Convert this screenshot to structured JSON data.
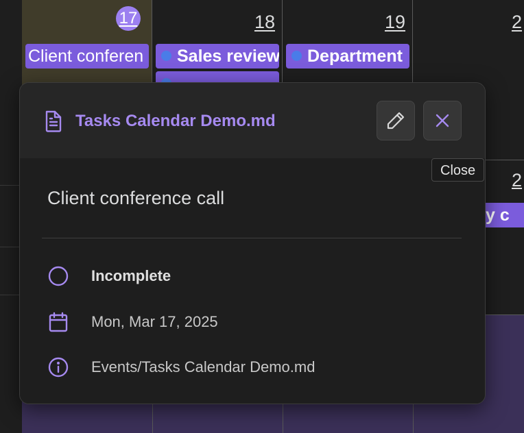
{
  "calendar": {
    "days": [
      {
        "number": "17"
      },
      {
        "number": "18"
      },
      {
        "number": "19"
      },
      {
        "number": "2"
      }
    ],
    "next_week_partial_number": "2",
    "events": [
      {
        "label": "Client conferen"
      },
      {
        "label": "Sales review"
      },
      {
        "label": "Department"
      },
      {
        "label": "try c"
      }
    ]
  },
  "popover": {
    "file_title": "Tasks Calendar Demo.md",
    "task_title": "Client conference call",
    "status": "Incomplete",
    "date": "Mon, Mar 17, 2025",
    "path": "Events/Tasks Calendar Demo.md",
    "tooltip": "Close"
  },
  "colors": {
    "accent": "#a68af0",
    "event_bg": "#7b5cdc",
    "event_dot": "#4a7ce8",
    "today_bg": "#403c2a",
    "today_badge": "#9c80f0"
  }
}
